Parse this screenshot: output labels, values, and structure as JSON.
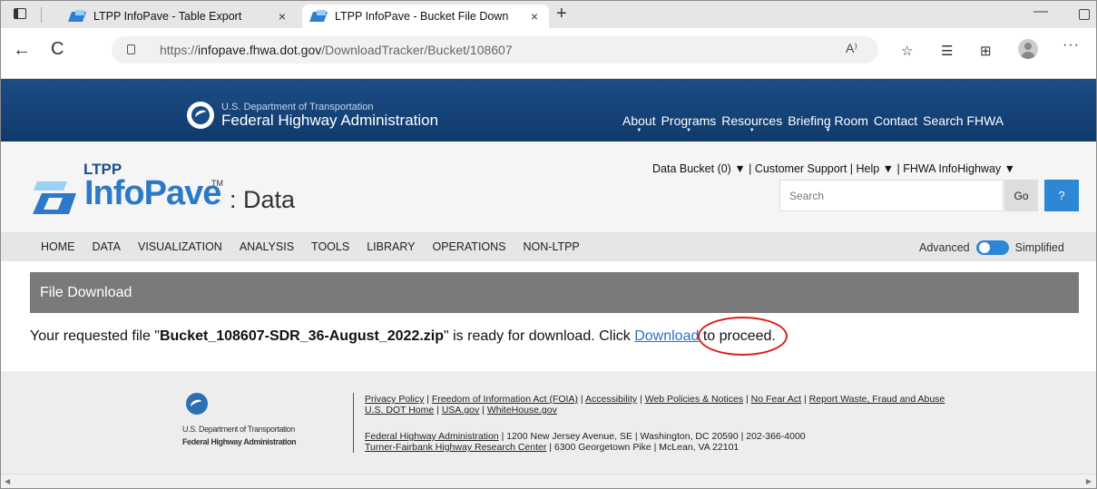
{
  "browser": {
    "tabs": [
      {
        "title": "LTPP InfoPave - Table Export",
        "close": "×"
      },
      {
        "title": "LTPP InfoPave - Bucket File Down",
        "close": "×"
      }
    ],
    "new_tab": "+",
    "minimize": "—",
    "url_prefix": "https://",
    "url_host": "infopave.fhwa.dot.gov",
    "url_path": "/DownloadTracker/Bucket/108607",
    "icons": [
      "tab-actions-icon",
      "back-icon",
      "refresh-icon",
      "lock-icon",
      "read-aloud-icon",
      "favorites-add-icon",
      "favorites-icon",
      "collections-icon",
      "profile-icon",
      "more-icon"
    ],
    "glyphs": {
      "back": "←",
      "refresh": "C",
      "read": "A⁾",
      "fav_add": "☆",
      "favorites": "☰",
      "collections": "⊞",
      "more": "···"
    }
  },
  "fhwa": {
    "dept": "U.S. Department of Transportation",
    "agency": "Federal Highway Administration",
    "nav": [
      "About",
      "Programs",
      "Resources",
      "Briefing Room",
      "Contact",
      "Search FHWA"
    ]
  },
  "infopave": {
    "ltpp": "LTPP",
    "brand": "InfoPave",
    "tm": "TM",
    "data": ": Data",
    "util_links": "Data Bucket (0) ▼  |  Customer Support  |  Help ▼  |  FHWA InfoHighway ▼",
    "search_placeholder": "Search",
    "go": "Go",
    "help": "?",
    "brand_color": "#2b79c7"
  },
  "main_nav": {
    "items": [
      "HOME",
      "DATA",
      "VISUALIZATION",
      "ANALYSIS",
      "TOOLS",
      "LIBRARY",
      "OPERATIONS",
      "NON-LTPP"
    ],
    "advanced": "Advanced",
    "simplified": "Simplified"
  },
  "content": {
    "section_title": "File Download",
    "msg_before": "Your requested file \"",
    "filename": "Bucket_108607-SDR_36-August_2022.zip",
    "msg_middle": "\" is ready for download. Click ",
    "download_link": "Download",
    "msg_after": " to proceed.",
    "highlight_color": "#d81f1f"
  },
  "footer": {
    "dept": "U.S. Department of Transportation",
    "agency": "Federal Highway Administration",
    "links_line1": [
      "Privacy Policy",
      "Freedom of Information Act (FOIA)",
      "Accessibility",
      "Web Policies & Notices",
      "No Fear Act",
      "Report Waste, Fraud and Abuse"
    ],
    "links_line2": [
      "U.S. DOT Home",
      "USA.gov",
      "WhiteHouse.gov"
    ],
    "addr_line1_link": "Federal Highway Administration",
    "addr_line1_text": " | 1200 New Jersey Avenue, SE | Washington, DC 20590 | 202-366-4000",
    "addr_line2_link": "Turner-Fairbank Highway Research Center",
    "addr_line2_text": " | 6300 Georgetown Pike | McLean, VA 22101"
  },
  "scroll": {
    "left": "◀",
    "right": "▶"
  }
}
